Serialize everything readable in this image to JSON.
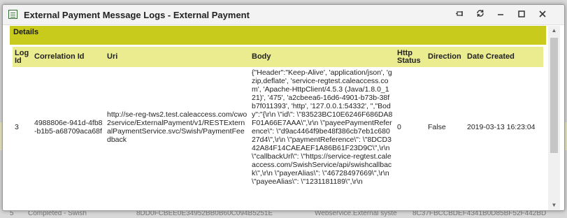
{
  "window": {
    "title": "External Payment Message Logs - External Payment"
  },
  "details": {
    "label": "Details"
  },
  "table": {
    "columns": [
      "Log Id",
      "Correlation Id",
      "Uri",
      "Body",
      "Http Status",
      "Direction",
      "Date Created"
    ],
    "row": {
      "log_id": "3",
      "correlation_id": "4988806e-941d-4fb8-b1b5-a68709aca68f",
      "uri": "http://se-reg-tws2.test.caleaccess.com/cwo2service/ExternalPayment/v1/RESTExternalPaymentService.svc/Swish/PaymentFeedback",
      "body": "{\"Header\":\"Keep-Alive', 'application/json', 'gzip,deflate', 'service-regtest.caleaccess.com', 'Apache-HttpClient/4.5.3 (Java/1.8.0_121)', '475', 'a2cbeea6-16d6-4901-b73b-38fb7f011393', 'http', '127.0.0.1:54332', \",\"Body\":\"{\\r\\n \\\"id\\\": \\\"83523BC10E6246F686DA8F01A66E7AAA\\\",\\r\\n \\\"payeePaymentReference\\\": \\\"d9ac4464f9be48f386cb7eb1c68027d4\\\",\\r\\n \\\"paymentReference\\\": \\\"8DCD342A84F14CAEAEF1A86B61F23D9C\\\",\\r\\n \\\"callbackUrl\\\": \\\"https://service-regtest.caleaccess.com/SwishService/api/swishcallback\\\",\\r\\n \\\"payerAlias\\\": \\\"46728497669\\\",\\r\\n \\\"payeeAlias\\\": \\\"1231181189\\\",\\r\\n",
      "http_status": "0",
      "direction": "False",
      "date_created": "2019-03-13 16:23:04"
    }
  },
  "background": {
    "row_text_1": "5",
    "row_text_2": "Completed - Swish",
    "row_text_3": "8DD0FCBEE0E34952BB0B60C094B5251E",
    "row_text_4": "Webservice.External syste",
    "row_text_5": "8C37FBCCBDEF4341B0D85BF52F442BD"
  },
  "colors": {
    "accent": "#c8cb1b",
    "header_row": "#ebeb8f"
  }
}
